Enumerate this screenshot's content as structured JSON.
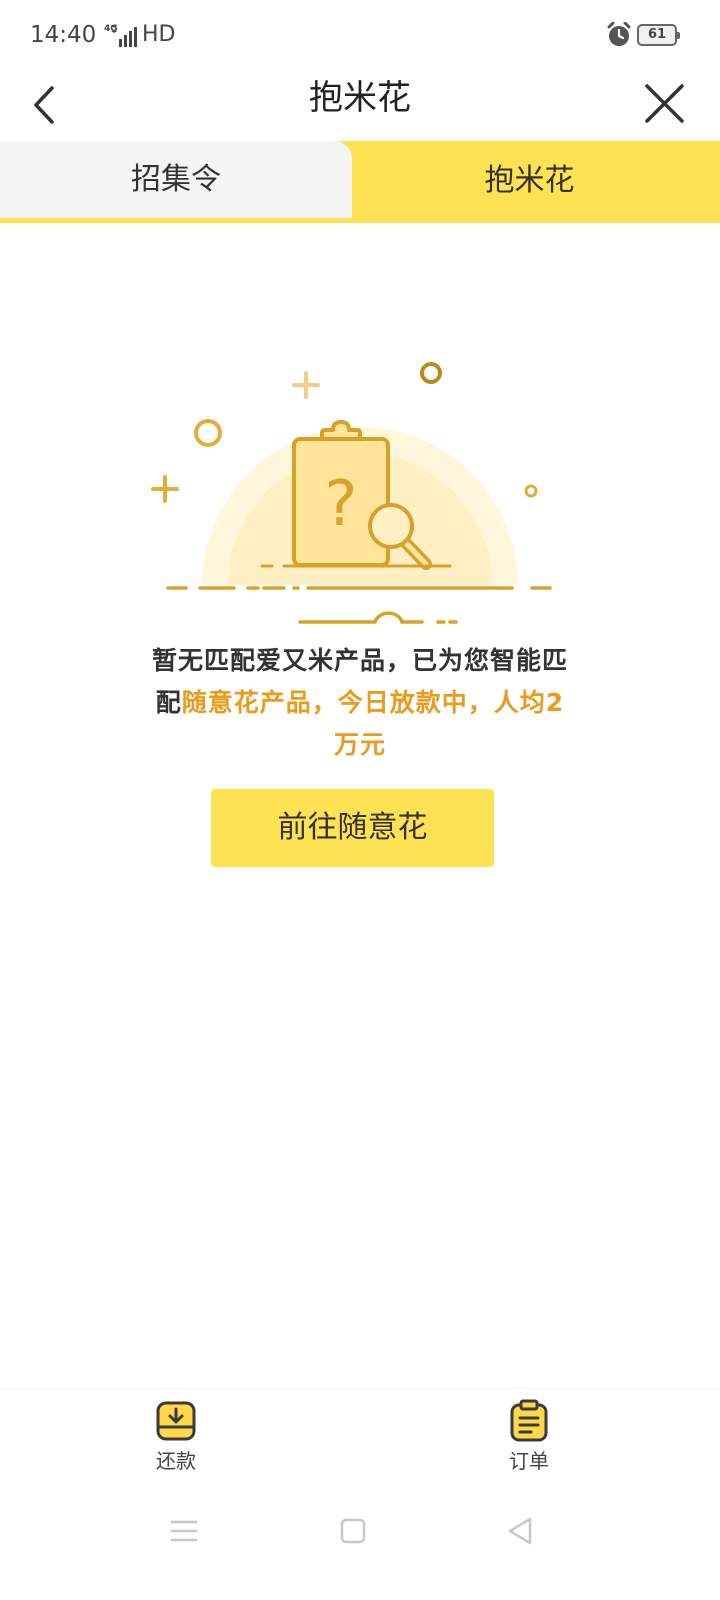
{
  "status": {
    "time": "14:40",
    "network": "4G",
    "hd": "HD",
    "battery": "61"
  },
  "nav": {
    "title": "抱米花"
  },
  "tabs": [
    {
      "label": "招集令",
      "active": false
    },
    {
      "label": "抱米花",
      "active": true
    }
  ],
  "empty": {
    "message_plain": "暂无匹配爱又米产品，已为您智能匹配",
    "message_highlight": "随意花产品，今日放款中，人均2万元",
    "button_label": "前往随意花"
  },
  "bottom_nav": [
    {
      "label": "还款",
      "icon": "download-tray-icon"
    },
    {
      "label": "订单",
      "icon": "clipboard-icon"
    }
  ],
  "colors": {
    "accent_yellow": "#ffe253",
    "highlight_orange": "#ea9b1a",
    "illustration_gold": "#d8a22a"
  }
}
